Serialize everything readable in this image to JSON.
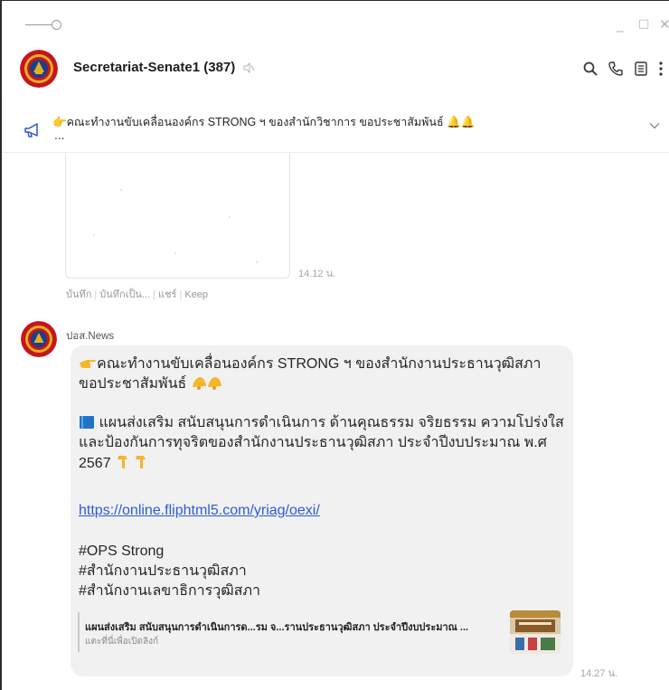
{
  "window": {
    "minimize_symbol": "_",
    "maximize_symbol": "□",
    "close_symbol": "✕"
  },
  "header": {
    "title": "Secretariat-Senate1 (387)",
    "icons": [
      "search-icon",
      "phone-icon",
      "notes-icon",
      "more-icon"
    ]
  },
  "announcement": {
    "text": "👉คณะทำงานขับเคลื่อนองค์กร STRONG ฯ ของสำนักวิชาการ ขอประชาสัมพันธ์ 🔔🔔",
    "more": "..."
  },
  "messages": {
    "image_time": "14.12 น.",
    "actions": [
      "บันทึก",
      "บันทึกเป็น...",
      "แชร์",
      "Keep"
    ],
    "post": {
      "sender": "ปอส.News",
      "line1": "คณะทำงานขับเคลื่อนองค์กร STRONG ฯ ของสำนักงานประธานวุฒิสภา",
      "line2": "ขอประชาสัมพันธ์",
      "line3": "แผนส่งเสริม สนับสนุนการดำเนินการ ด้านคุณธรรม จริยธรรม ความโปร่งใส",
      "line4": "และป้องกันการทุจริตของสำนักงานประธานวุฒิสภา ประจำปีงบประมาณ พ.ศ",
      "line5": "2567",
      "link": "https://online.fliphtml5.com/yriag/oexi/",
      "tag1": "#OPS Strong",
      "tag2": "#สำนักงานประธานวุฒิสภา",
      "tag3": "#สำนักงานเลขาธิการวุฒิสภา",
      "preview_title": "แผนส่งเสริม สนับสนุนการดำเนินการด...รม จ...รานประธานวุฒิสภา ประจำปีงบประมาณ ...",
      "preview_subtitle": "แตะที่นี่เพื่อเปิดลิงก์",
      "time": "14.27 น."
    }
  },
  "colors": {
    "bubble": "#f1f1f1",
    "link": "#2b5bd7",
    "seal_red": "#c8141e",
    "seal_gold": "#e0b020"
  }
}
